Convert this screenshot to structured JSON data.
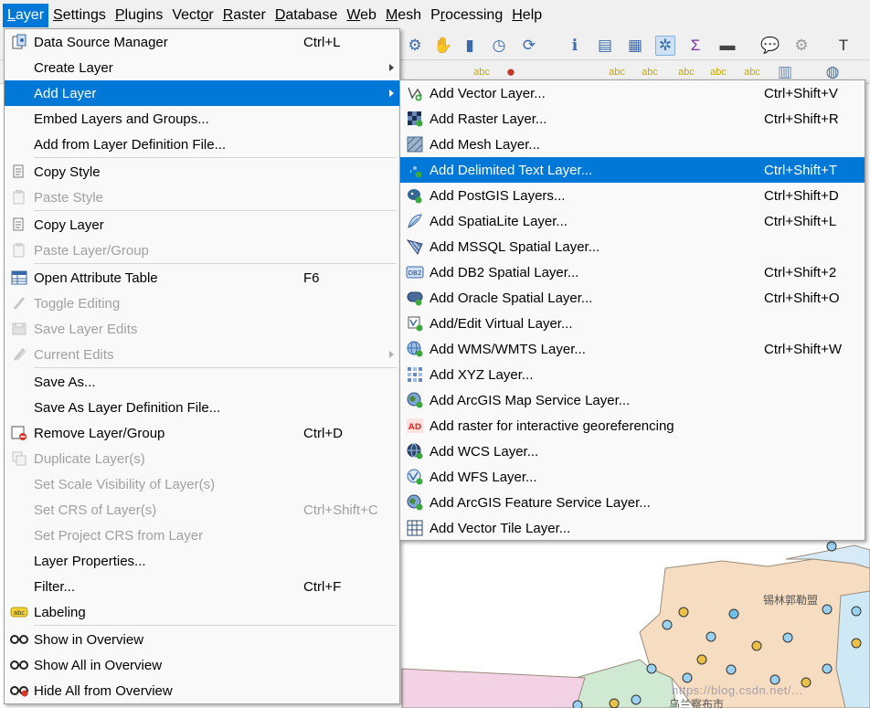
{
  "menubar": {
    "items": [
      {
        "label": "Layer",
        "mnemonic": "L"
      },
      {
        "label": "Settings",
        "mnemonic": "S"
      },
      {
        "label": "Plugins",
        "mnemonic": "P"
      },
      {
        "label": "Vector",
        "mnemonic": "o"
      },
      {
        "label": "Raster",
        "mnemonic": "R"
      },
      {
        "label": "Database",
        "mnemonic": "D"
      },
      {
        "label": "Web",
        "mnemonic": "W"
      },
      {
        "label": "Mesh",
        "mnemonic": "M"
      },
      {
        "label": "Processing",
        "mnemonic": "r"
      },
      {
        "label": "Help",
        "mnemonic": "H"
      }
    ],
    "active_item": "Layer"
  },
  "layer_menu": {
    "items": [
      {
        "label": "Data Source Manager",
        "shortcut": "Ctrl+L",
        "icon": "data-source-manager-icon",
        "enabled": true
      },
      {
        "label": "Create Layer",
        "submenu": true,
        "enabled": true
      },
      {
        "label": "Add Layer",
        "submenu": true,
        "highlighted": true,
        "enabled": true
      },
      {
        "label": "Embed Layers and Groups...",
        "enabled": true
      },
      {
        "label": "Add from Layer Definition File...",
        "enabled": true
      },
      {
        "separator": true
      },
      {
        "label": "Copy Style",
        "icon": "copy-style-icon",
        "enabled": true
      },
      {
        "label": "Paste Style",
        "icon": "paste-style-icon",
        "enabled": false
      },
      {
        "separator": true
      },
      {
        "label": "Copy Layer",
        "icon": "copy-layer-icon",
        "enabled": true
      },
      {
        "label": "Paste Layer/Group",
        "icon": "paste-layer-icon",
        "enabled": false
      },
      {
        "separator": true
      },
      {
        "label": "Open Attribute Table",
        "shortcut": "F6",
        "icon": "attribute-table-icon",
        "enabled": true
      },
      {
        "label": "Toggle Editing",
        "icon": "pencil-icon",
        "enabled": false
      },
      {
        "label": "Save Layer Edits",
        "icon": "save-edits-icon",
        "enabled": false
      },
      {
        "label": "Current Edits",
        "icon": "current-edits-icon",
        "submenu": true,
        "enabled": false
      },
      {
        "separator": true
      },
      {
        "label": "Save As...",
        "enabled": true
      },
      {
        "label": "Save As Layer Definition File...",
        "enabled": true
      },
      {
        "label": "Remove Layer/Group",
        "shortcut": "Ctrl+D",
        "icon": "remove-layer-icon",
        "enabled": true
      },
      {
        "label": "Duplicate Layer(s)",
        "icon": "duplicate-layer-icon",
        "enabled": false
      },
      {
        "label": "Set Scale Visibility of Layer(s)",
        "enabled": false
      },
      {
        "label": "Set CRS of Layer(s)",
        "shortcut": "Ctrl+Shift+C",
        "enabled": false
      },
      {
        "label": "Set Project CRS from Layer",
        "enabled": false
      },
      {
        "label": "Layer Properties...",
        "enabled": true
      },
      {
        "label": "Filter...",
        "shortcut": "Ctrl+F",
        "enabled": true
      },
      {
        "label": "Labeling",
        "icon": "labeling-icon",
        "enabled": true
      },
      {
        "separator": true
      },
      {
        "label": "Show in Overview",
        "icon": "glasses-icon",
        "enabled": true
      },
      {
        "label": "Show All in Overview",
        "icon": "glasses-icon",
        "enabled": true
      },
      {
        "label": "Hide All from Overview",
        "icon": "glasses-hide-icon",
        "enabled": true
      }
    ]
  },
  "add_layer_submenu": {
    "items": [
      {
        "label": "Add Vector Layer...",
        "shortcut": "Ctrl+Shift+V",
        "icon": "vector-layer-icon"
      },
      {
        "label": "Add Raster Layer...",
        "shortcut": "Ctrl+Shift+R",
        "icon": "raster-layer-icon"
      },
      {
        "label": "Add Mesh Layer...",
        "icon": "mesh-layer-icon"
      },
      {
        "label": "Add Delimited Text Layer...",
        "shortcut": "Ctrl+Shift+T",
        "icon": "delimited-text-icon",
        "highlighted": true
      },
      {
        "label": "Add PostGIS Layers...",
        "shortcut": "Ctrl+Shift+D",
        "icon": "postgis-icon"
      },
      {
        "label": "Add SpatiaLite Layer...",
        "shortcut": "Ctrl+Shift+L",
        "icon": "spatialite-icon"
      },
      {
        "label": "Add MSSQL Spatial Layer...",
        "icon": "mssql-icon"
      },
      {
        "label": "Add DB2 Spatial Layer...",
        "shortcut": "Ctrl+Shift+2",
        "icon": "db2-icon"
      },
      {
        "label": "Add Oracle Spatial Layer...",
        "shortcut": "Ctrl+Shift+O",
        "icon": "oracle-icon"
      },
      {
        "label": "Add/Edit Virtual Layer...",
        "icon": "virtual-layer-icon"
      },
      {
        "label": "Add WMS/WMTS Layer...",
        "shortcut": "Ctrl+Shift+W",
        "icon": "wms-icon"
      },
      {
        "label": "Add XYZ Layer...",
        "icon": "xyz-icon"
      },
      {
        "label": "Add ArcGIS Map Service Layer...",
        "icon": "arcgis-map-icon"
      },
      {
        "label": "Add raster for interactive georeferencing",
        "icon": "georeferencing-icon",
        "icon_text": "AD"
      },
      {
        "label": "Add WCS Layer...",
        "icon": "wcs-icon"
      },
      {
        "label": "Add WFS Layer...",
        "icon": "wfs-icon"
      },
      {
        "label": "Add ArcGIS Feature Service Layer...",
        "icon": "arcgis-feature-icon"
      },
      {
        "label": "Add Vector Tile Layer...",
        "icon": "vector-tile-icon"
      }
    ]
  },
  "map": {
    "place_label": "锡林郭勒盟",
    "place_label_2": "乌兰察布市",
    "watermark": "https://blog.csdn.net/..."
  },
  "colors": {
    "highlight": "#0078d7",
    "menu_bg": "#f9f9f9",
    "disabled_text": "#a0a0a0",
    "map_fill_orange": "#f6dcc0",
    "map_fill_green": "#cfe9d2",
    "map_fill_blue": "#cfe8f5",
    "map_fill_pink": "#f3d2e6"
  }
}
